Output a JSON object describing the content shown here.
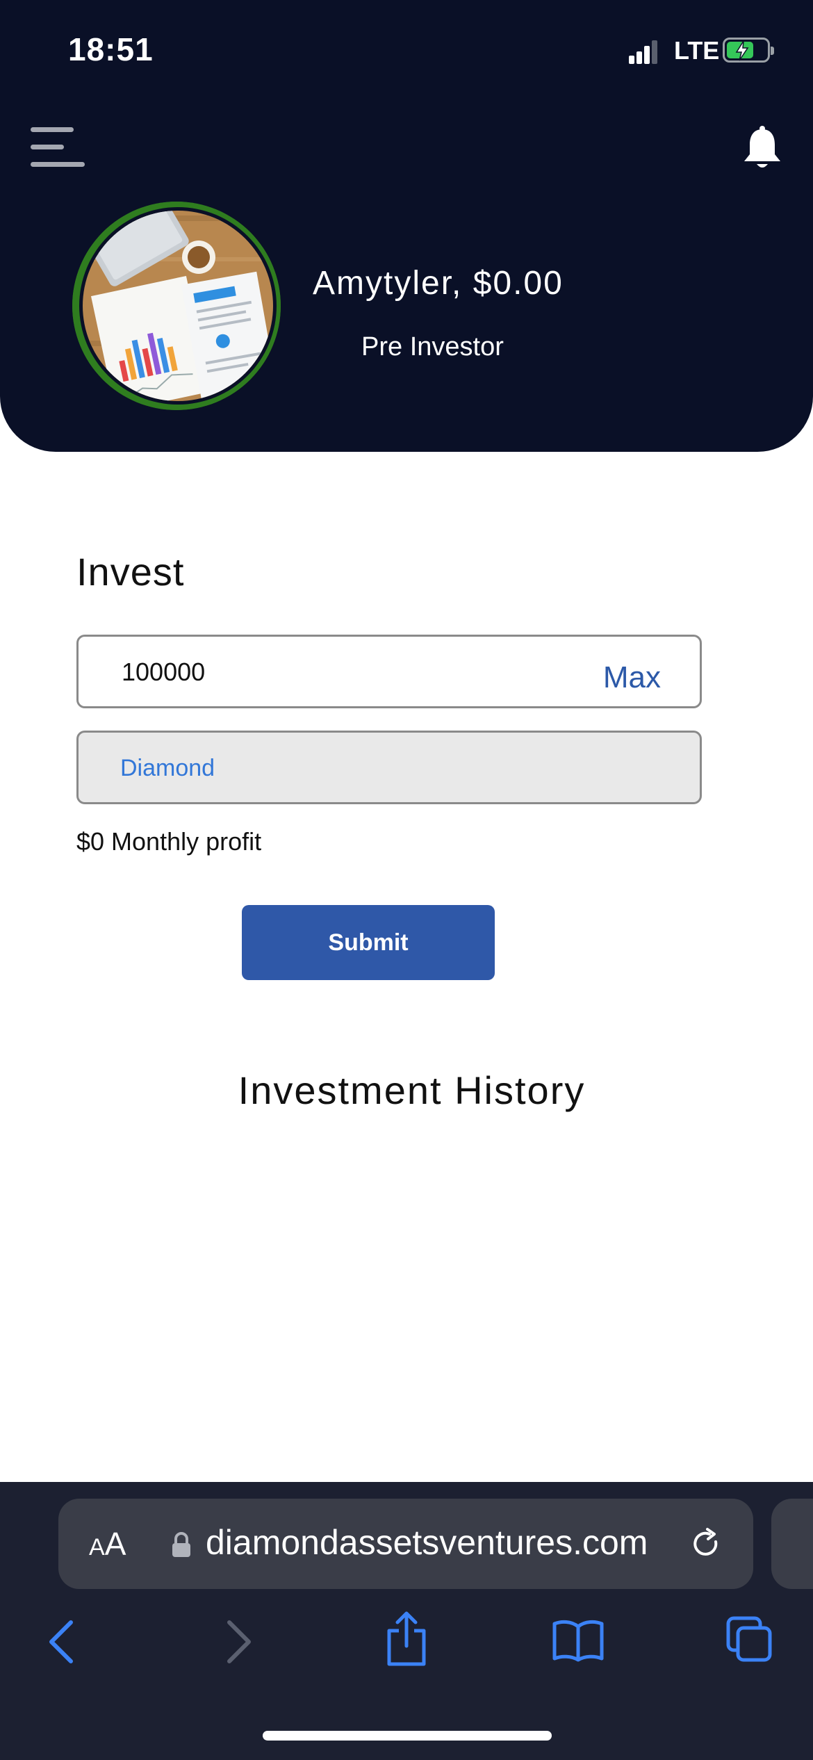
{
  "status_bar": {
    "time": "18:51",
    "network": "LTE"
  },
  "header": {
    "menu_icon": "menu-icon",
    "bell_icon": "bell-icon",
    "user_name_balance": "Amytyler, $0.00",
    "user_tier": "Pre Investor",
    "avatar_ring_color": "#2f7d1f",
    "background_color": "#0a1027"
  },
  "invest": {
    "title": "Invest",
    "amount_value": "100000",
    "max_label": "Max",
    "plan_value": "Diamond",
    "monthly_profit": "$0 Monthly profit",
    "submit_label": "Submit",
    "accent_color": "#2f58a8"
  },
  "history": {
    "title": "Investment History"
  },
  "browser": {
    "aa_small": "A",
    "aa_large": "A",
    "url": "diamondassetsventures.com",
    "icons": [
      "back-icon",
      "forward-icon",
      "share-icon",
      "bookmarks-icon",
      "tabs-icon"
    ]
  }
}
